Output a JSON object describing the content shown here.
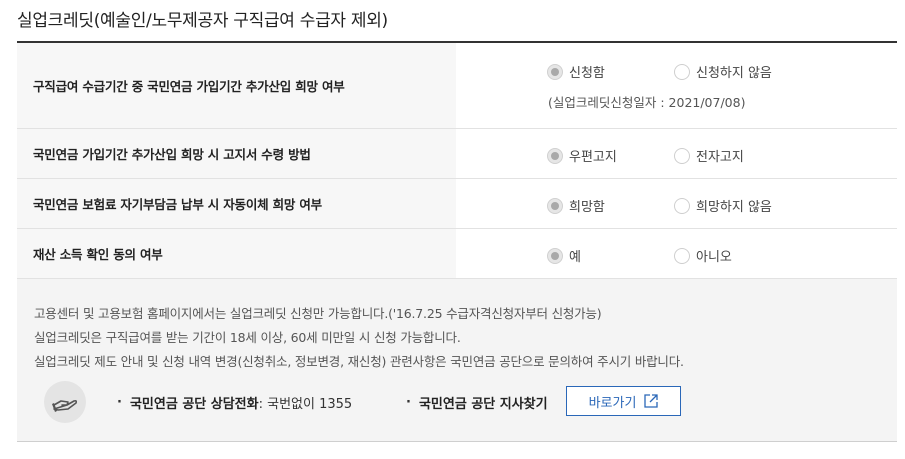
{
  "title": "실업크레딧(예술인/노무제공자 구직급여 수급자 제외)",
  "rows": [
    {
      "label": "구직급여 수급기간 중 국민연금 가입기간 추가산입 희망 여부",
      "options": [
        "신청함",
        "신청하지 않음"
      ],
      "selected": 0,
      "note": "(실업크레딧신청일자 : 2021/07/08)"
    },
    {
      "label": "국민연금 가입기간 추가산입 희망 시 고지서 수령 방법",
      "options": [
        "우편고지",
        "전자고지"
      ],
      "selected": 0
    },
    {
      "label": "국민연금 보험료 자기부담금 납부 시 자동이체 희망 여부",
      "options": [
        "희망함",
        "희망하지 않음"
      ],
      "selected": 0
    },
    {
      "label": "재산 소득 확인 동의 여부",
      "options": [
        "예",
        "아니오"
      ],
      "selected": 0
    }
  ],
  "info": {
    "lines": [
      "고용센터 및 고용보험 홈페이지에서는 실업크레딧 신청만 가능합니다.('16.7.25 수급자격신청자부터 신청가능)",
      "실업크레딧은 구직급여를 받는 기간이 18세 이상, 60세 미만일 시 신청 가능합니다.",
      "실업크레딧 제도 안내 및 신청 내역 변경(신청취소, 정보변경, 재신청) 관련사항은 국민연금 공단으로 문의하여 주시기 바랍니다."
    ],
    "phone_label": "국민연금 공단 상담전화",
    "phone_value": " : 국번없이 1355",
    "branch_label": "국민연금 공단 지사찾기",
    "go_button": "바로가기"
  }
}
